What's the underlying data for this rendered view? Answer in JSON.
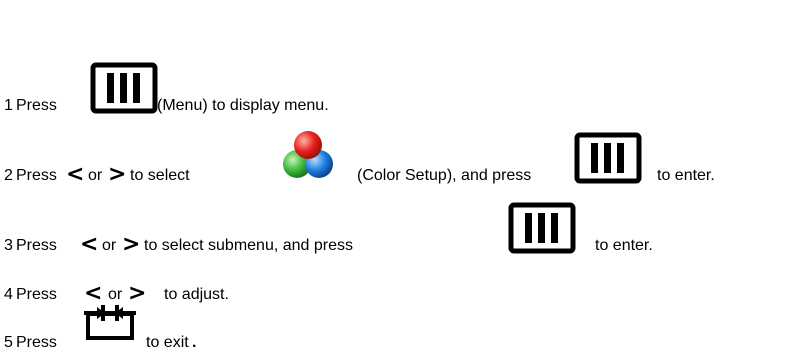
{
  "steps": [
    {
      "number": "1",
      "parts": [
        "Press",
        "(Menu) to display menu."
      ]
    },
    {
      "number": "2",
      "parts": [
        "Press",
        "<",
        "or",
        ">",
        "to select",
        "(Color Setup), and press",
        "to enter."
      ]
    },
    {
      "number": "3",
      "parts": [
        "Press",
        "<",
        "or",
        ">",
        "to select submenu, and press",
        "to enter."
      ]
    },
    {
      "number": "4",
      "parts": [
        "Press",
        "<",
        "or",
        ">",
        "to adjust."
      ]
    },
    {
      "number": "5",
      "parts": [
        "Press",
        "to exit",
        "."
      ]
    }
  ],
  "icons": {
    "menu": "menu-button-icon",
    "color_setup": "color-setup-icon",
    "exit": "exit-button-icon"
  },
  "colors": {
    "text": "#000000",
    "color_setup_red": "#e8201c",
    "color_setup_green": "#3db83a",
    "color_setup_blue": "#1e7fe0"
  }
}
